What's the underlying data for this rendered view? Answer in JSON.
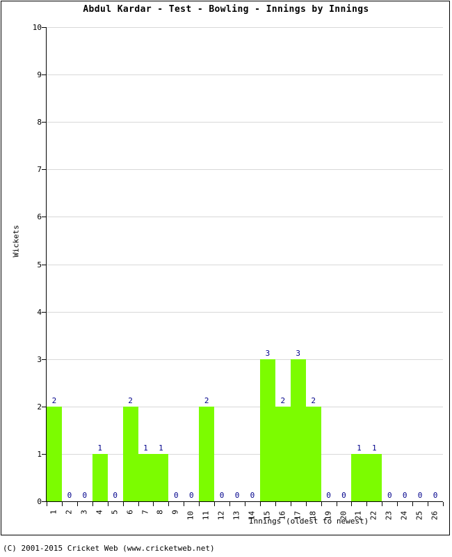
{
  "chart_data": {
    "type": "bar",
    "title": "Abdul Kardar - Test - Bowling - Innings by Innings",
    "xlabel": "Innings (oldest to newest)",
    "ylabel": "Wickets",
    "categories": [
      "1",
      "2",
      "3",
      "4",
      "5",
      "6",
      "7",
      "8",
      "9",
      "10",
      "11",
      "12",
      "13",
      "14",
      "15",
      "16",
      "17",
      "18",
      "19",
      "20",
      "21",
      "22",
      "23",
      "24",
      "25",
      "26"
    ],
    "values": [
      2,
      0,
      0,
      1,
      0,
      2,
      1,
      1,
      0,
      0,
      2,
      0,
      0,
      0,
      3,
      2,
      3,
      2,
      0,
      0,
      1,
      1,
      0,
      0,
      0,
      0
    ],
    "value_labels": [
      "2",
      "0",
      "0",
      "1",
      "0",
      "2",
      "1",
      "1",
      "0",
      "0",
      "2",
      "0",
      "0",
      "0",
      "3",
      "2",
      "3",
      "2",
      "0",
      "0",
      "1",
      "1",
      "0",
      "0",
      "0",
      "0"
    ],
    "ylim": [
      0,
      10
    ],
    "yticks": [
      0,
      1,
      2,
      3,
      4,
      5,
      6,
      7,
      8,
      9,
      10
    ],
    "ytick_labels": [
      "0",
      "1",
      "2",
      "3",
      "4",
      "5",
      "6",
      "7",
      "8",
      "9",
      "10"
    ],
    "grid": true,
    "legend": "none",
    "bar_color": "#7cfc00",
    "label_color": "#00008b",
    "grid_color": "#d8d8d8",
    "axis_color": "#000000"
  },
  "footer": {
    "copyright": "(C) 2001-2015 Cricket Web (www.cricketweb.net)"
  }
}
